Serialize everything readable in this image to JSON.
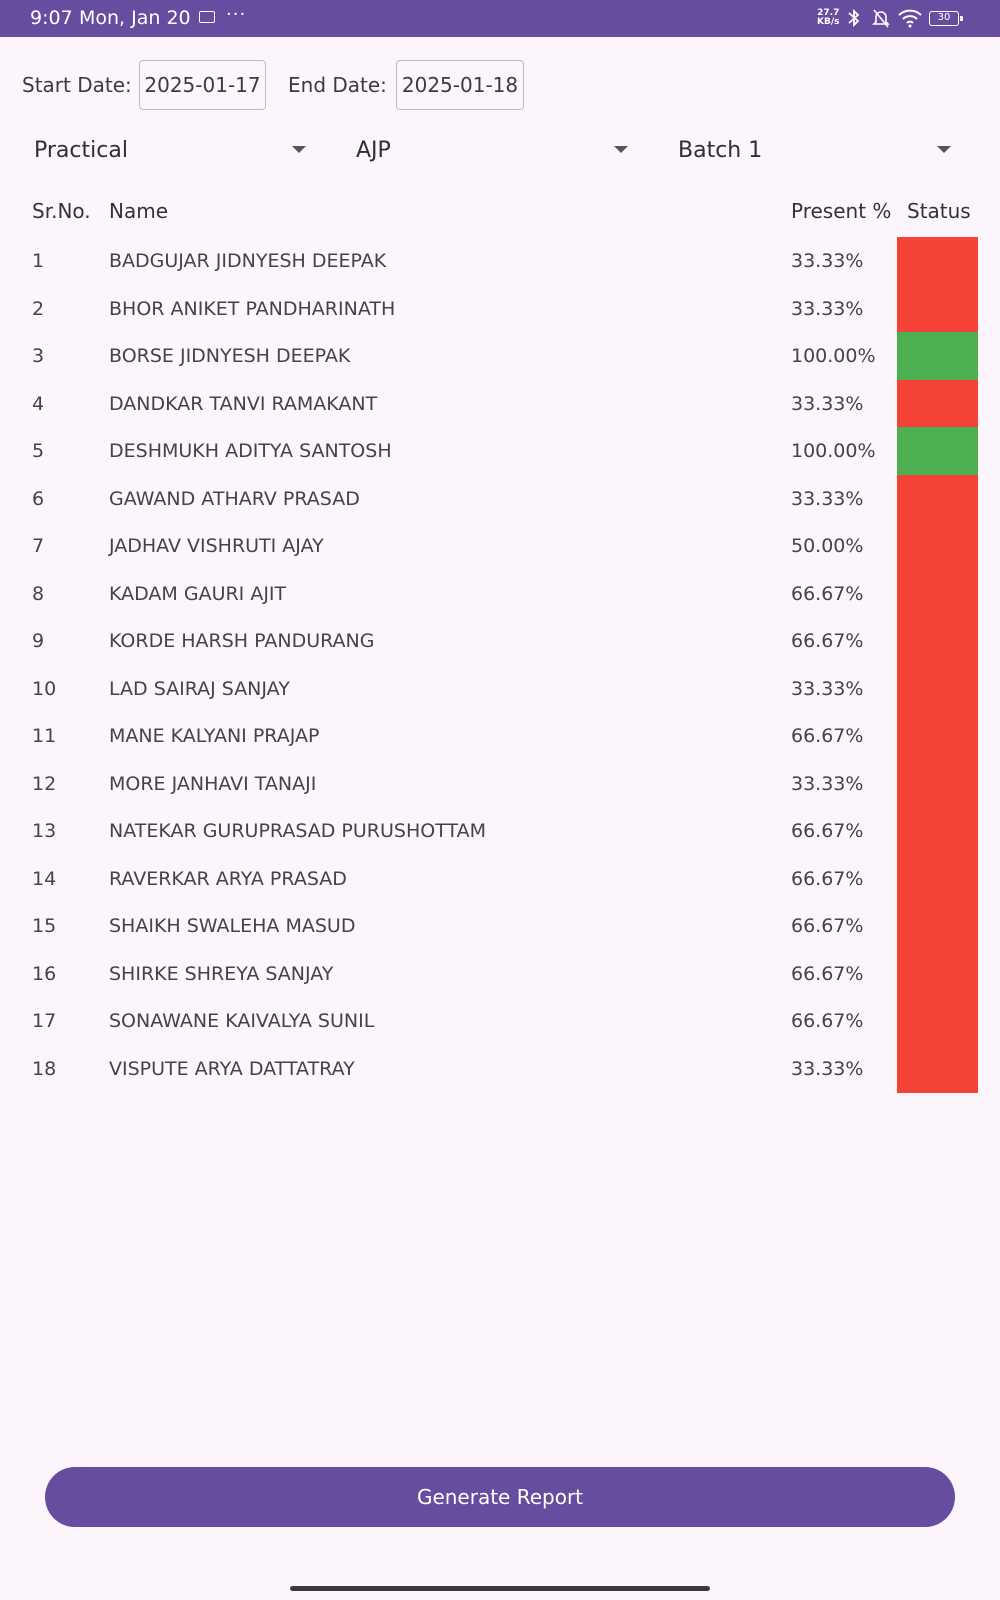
{
  "status_bar": {
    "time": "9:07",
    "date": "Mon, Jan 20",
    "more": "···",
    "net_speed_value": "27.7",
    "net_speed_unit": "KB/s",
    "battery": "30"
  },
  "filters": {
    "start_label": "Start Date:",
    "start_value": "2025-01-17",
    "end_label": "End Date:",
    "end_value": "2025-01-18",
    "type_selected": "Practical",
    "subject_selected": "AJP",
    "batch_selected": "Batch 1"
  },
  "table": {
    "headers": {
      "srno": "Sr.No.",
      "name": "Name",
      "present": "Present %",
      "status": "Status"
    },
    "rows": [
      {
        "sr": "1",
        "name": "BADGUJAR JIDNYESH DEEPAK",
        "present": "33.33%",
        "status_color": "#f44336"
      },
      {
        "sr": "2",
        "name": "BHOR ANIKET PANDHARINATH",
        "present": "33.33%",
        "status_color": "#f44336"
      },
      {
        "sr": "3",
        "name": "BORSE JIDNYESH DEEPAK",
        "present": "100.00%",
        "status_color": "#4caf50"
      },
      {
        "sr": "4",
        "name": "DANDKAR TANVI RAMAKANT",
        "present": "33.33%",
        "status_color": "#f44336"
      },
      {
        "sr": "5",
        "name": "DESHMUKH ADITYA SANTOSH",
        "present": "100.00%",
        "status_color": "#4caf50"
      },
      {
        "sr": "6",
        "name": "GAWAND ATHARV PRASAD",
        "present": "33.33%",
        "status_color": "#f44336"
      },
      {
        "sr": "7",
        "name": "JADHAV VISHRUTI AJAY",
        "present": "50.00%",
        "status_color": "#f44336"
      },
      {
        "sr": "8",
        "name": "KADAM GAURI AJIT",
        "present": "66.67%",
        "status_color": "#f44336"
      },
      {
        "sr": "9",
        "name": "KORDE HARSH PANDURANG",
        "present": "66.67%",
        "status_color": "#f44336"
      },
      {
        "sr": "10",
        "name": "LAD SAIRAJ SANJAY",
        "present": "33.33%",
        "status_color": "#f44336"
      },
      {
        "sr": "11",
        "name": "MANE KALYANI PRAJAP",
        "present": "66.67%",
        "status_color": "#f44336"
      },
      {
        "sr": "12",
        "name": "MORE JANHAVI TANAJI",
        "present": "33.33%",
        "status_color": "#f44336"
      },
      {
        "sr": "13",
        "name": "NATEKAR GURUPRASAD PURUSHOTTAM",
        "present": "66.67%",
        "status_color": "#f44336"
      },
      {
        "sr": "14",
        "name": "RAVERKAR ARYA PRASAD",
        "present": "66.67%",
        "status_color": "#f44336"
      },
      {
        "sr": "15",
        "name": "SHAIKH SWALEHA MASUD",
        "present": "66.67%",
        "status_color": "#f44336"
      },
      {
        "sr": "16",
        "name": "SHIRKE SHREYA SANJAY",
        "present": "66.67%",
        "status_color": "#f44336"
      },
      {
        "sr": "17",
        "name": "SONAWANE KAIVALYA SUNIL",
        "present": "66.67%",
        "status_color": "#f44336"
      },
      {
        "sr": "18",
        "name": "VISPUTE ARYA DATTATRAY",
        "present": "33.33%",
        "status_color": "#f44336"
      }
    ]
  },
  "actions": {
    "generate_label": "Generate Report"
  },
  "colors": {
    "accent": "#664d9f",
    "status_low": "#f44336",
    "status_ok": "#4caf50",
    "background": "#fcf5fc"
  }
}
